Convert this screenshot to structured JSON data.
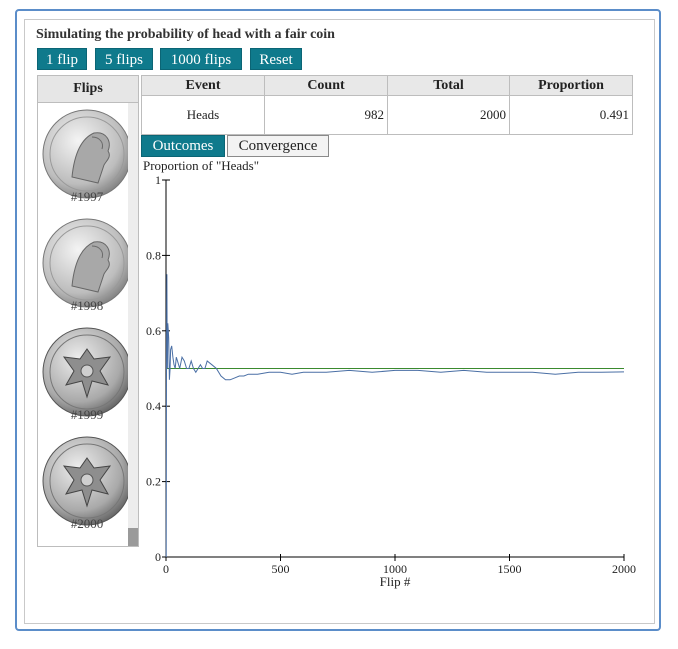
{
  "title": "Simulating the probability of head with a fair coin",
  "buttons": {
    "flip1": "1 flip",
    "flip5": "5 flips",
    "flip1000": "1000 flips",
    "reset": "Reset"
  },
  "flips_panel": {
    "header": "Flips",
    "items": [
      {
        "label": "#1997",
        "side": "heads"
      },
      {
        "label": "#1998",
        "side": "heads"
      },
      {
        "label": "#1999",
        "side": "tails"
      },
      {
        "label": "#2000",
        "side": "tails"
      }
    ]
  },
  "table": {
    "headers": [
      "Event",
      "Count",
      "Total",
      "Proportion"
    ],
    "row": {
      "event": "Heads",
      "count": "982",
      "total": "2000",
      "proportion": "0.491"
    }
  },
  "tabs": {
    "outcomes": "Outcomes",
    "convergence": "Convergence"
  },
  "colors": {
    "accent": "#0f7a8c",
    "series": "#4a6fa5",
    "reference": "#3a8a2e",
    "border": "#5b8dc9"
  },
  "chart_data": {
    "type": "line",
    "ylabel": "Proportion of \"Heads\"",
    "xlabel": "Flip #",
    "xlim": [
      0,
      2000
    ],
    "ylim": [
      0,
      1
    ],
    "x_ticks": [
      "0",
      "500",
      "1000",
      "1500",
      "2000"
    ],
    "y_ticks": [
      "0",
      "0.2",
      "0.4",
      "0.6",
      "0.8",
      "1"
    ],
    "reference_line": 0.5,
    "series": [
      {
        "x": [
          1,
          2,
          3,
          4,
          5,
          6,
          8,
          10,
          12,
          15,
          18,
          20,
          25,
          30,
          35,
          40,
          45,
          50,
          60,
          70,
          80,
          90,
          100,
          110,
          120,
          130,
          140,
          150,
          160,
          170,
          180,
          200,
          220,
          240,
          260,
          280,
          300,
          320,
          340,
          360,
          400,
          450,
          500,
          550,
          600,
          700,
          800,
          900,
          1000,
          1100,
          1200,
          1300,
          1400,
          1500,
          1600,
          1700,
          1800,
          1900,
          2000
        ],
        "y": [
          0,
          0.5,
          0.67,
          0.75,
          0.6,
          0.5,
          0.62,
          0.6,
          0.58,
          0.47,
          0.5,
          0.55,
          0.56,
          0.53,
          0.51,
          0.5,
          0.53,
          0.52,
          0.5,
          0.53,
          0.52,
          0.5,
          0.5,
          0.52,
          0.5,
          0.49,
          0.5,
          0.51,
          0.5,
          0.5,
          0.52,
          0.51,
          0.5,
          0.48,
          0.47,
          0.47,
          0.475,
          0.48,
          0.48,
          0.485,
          0.485,
          0.49,
          0.49,
          0.485,
          0.49,
          0.49,
          0.495,
          0.49,
          0.495,
          0.495,
          0.49,
          0.495,
          0.49,
          0.49,
          0.49,
          0.485,
          0.49,
          0.49,
          0.491
        ]
      }
    ]
  }
}
